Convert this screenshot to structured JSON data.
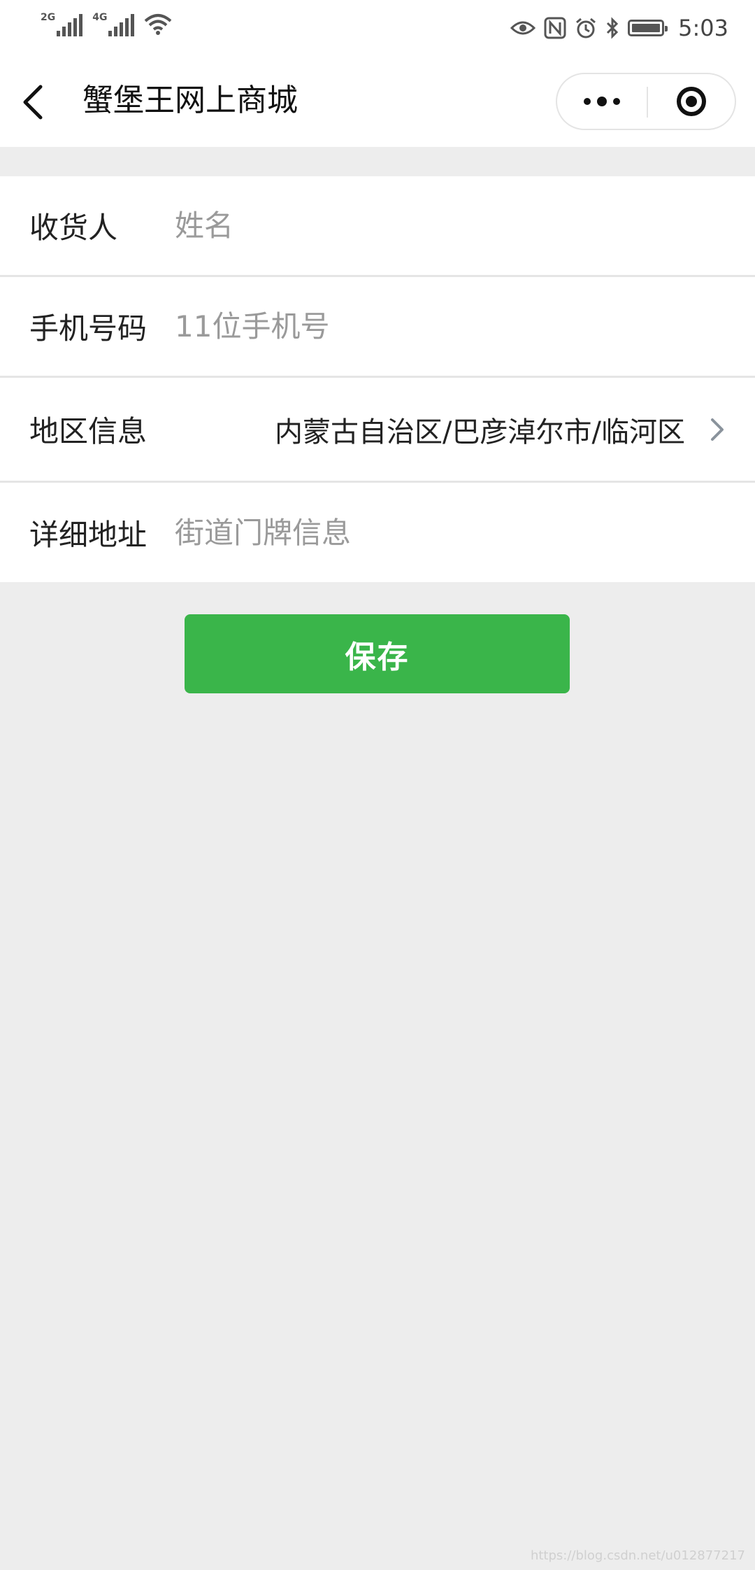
{
  "status_bar": {
    "network1": "2G",
    "network2": "4G",
    "time": "5:03",
    "icons": [
      "eye-icon",
      "nfc-icon",
      "alarm-icon",
      "bluetooth-icon",
      "battery-icon"
    ]
  },
  "header": {
    "title": "蟹堡王网上商城",
    "back_icon": "back-chevron-icon",
    "more_icon": "more-dots-icon",
    "close_icon": "close-target-icon"
  },
  "form": {
    "recipient": {
      "label": "收货人",
      "placeholder": "姓名",
      "value": ""
    },
    "phone": {
      "label": "手机号码",
      "placeholder": "11位手机号",
      "value": ""
    },
    "region": {
      "label": "地区信息",
      "value": "内蒙古自治区/巴彦淖尔市/临河区",
      "icon": "chevron-right-icon"
    },
    "address": {
      "label": "详细地址",
      "placeholder": "街道门牌信息",
      "value": ""
    }
  },
  "actions": {
    "save_label": "保存"
  },
  "colors": {
    "primary": "#3ab54a",
    "background": "#ededed"
  },
  "watermark": "https://blog.csdn.net/u012877217"
}
